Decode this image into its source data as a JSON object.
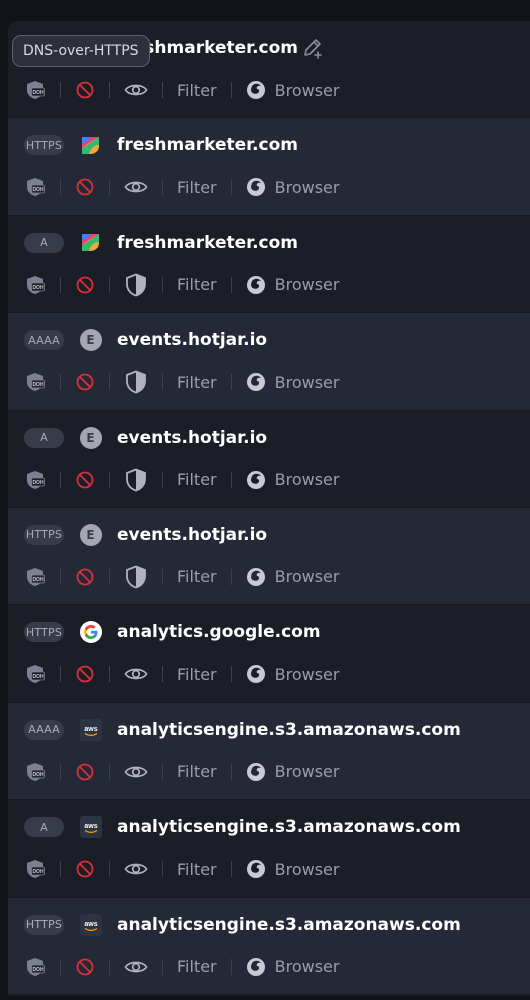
{
  "tooltip": {
    "text": "DNS-over-HTTPS"
  },
  "labels": {
    "filter": "Filter",
    "browser": "Browser"
  },
  "rows": [
    {
      "type": "",
      "domain": "freshmarketer.com",
      "icon": "freshmarketer-logo",
      "action": "eye"
    },
    {
      "type": "HTTPS",
      "domain": "freshmarketer.com",
      "icon": "freshmarketer-logo",
      "action": "eye"
    },
    {
      "type": "A",
      "domain": "freshmarketer.com",
      "icon": "freshmarketer-logo",
      "action": "shield"
    },
    {
      "type": "AAAA",
      "domain": "events.hotjar.io",
      "icon": "letter-e",
      "letter": "E",
      "action": "shield"
    },
    {
      "type": "A",
      "domain": "events.hotjar.io",
      "icon": "letter-e",
      "letter": "E",
      "action": "shield"
    },
    {
      "type": "HTTPS",
      "domain": "events.hotjar.io",
      "icon": "letter-e",
      "letter": "E",
      "action": "shield"
    },
    {
      "type": "HTTPS",
      "domain": "analytics.google.com",
      "icon": "google-logo",
      "action": "eye"
    },
    {
      "type": "AAAA",
      "domain": "analyticsengine.s3.amazonaws.com",
      "icon": "aws-logo",
      "action": "eye"
    },
    {
      "type": "A",
      "domain": "analyticsengine.s3.amazonaws.com",
      "icon": "aws-logo",
      "action": "eye"
    },
    {
      "type": "HTTPS",
      "domain": "analyticsengine.s3.amazonaws.com",
      "icon": "aws-logo",
      "action": "eye"
    }
  ],
  "colors": {
    "background": "#111318",
    "row_dark": "#1b1d27",
    "row_light": "#252836",
    "block_red": "#d8313a",
    "muted": "#9a9daa"
  }
}
